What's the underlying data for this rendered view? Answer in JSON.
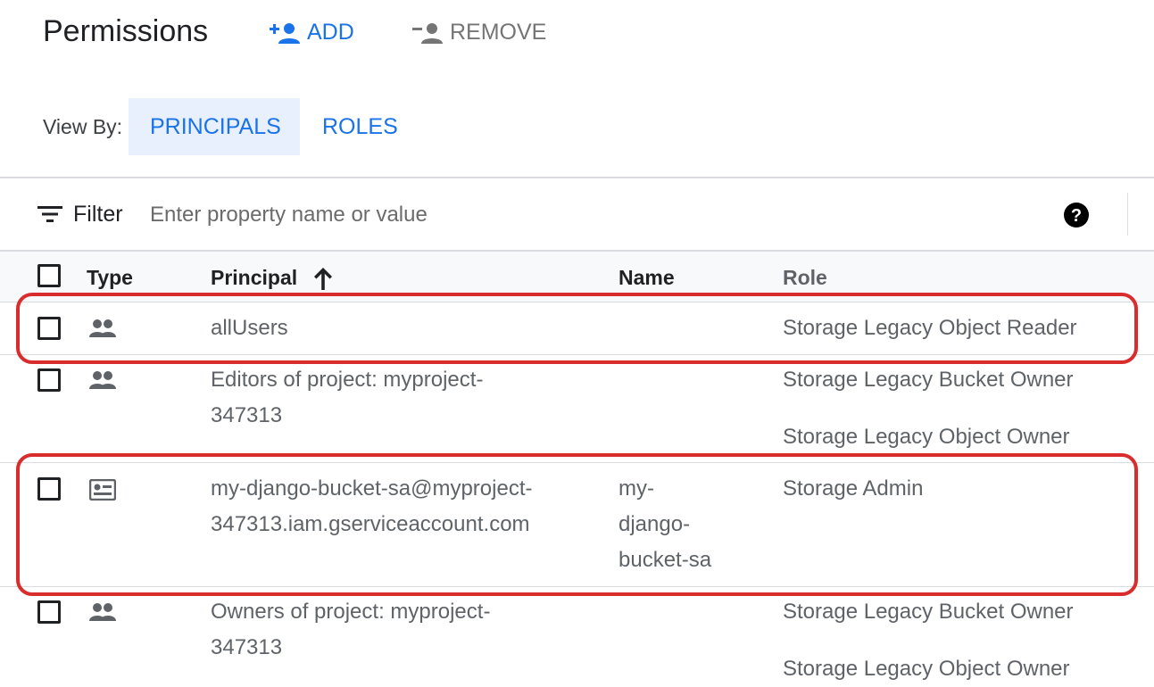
{
  "page": {
    "title": "Permissions",
    "add_label": "ADD",
    "remove_label": "REMOVE"
  },
  "view": {
    "label": "View By:",
    "tabs": [
      {
        "label": "PRINCIPALS",
        "active": true
      },
      {
        "label": "ROLES",
        "active": false
      }
    ]
  },
  "filter": {
    "label": "Filter",
    "placeholder": "Enter property name or value"
  },
  "table": {
    "columns": {
      "type": "Type",
      "principal": "Principal",
      "name": "Name",
      "role": "Role"
    },
    "sort": {
      "column": "Principal",
      "direction": "ascending"
    },
    "rows": [
      {
        "type_icon": "group-icon",
        "principal_lines": [
          "allUsers"
        ],
        "name_lines": [],
        "roles": [
          "Storage Legacy Object Reader"
        ]
      },
      {
        "type_icon": "group-icon",
        "principal_lines": [
          "Editors of project: myproject-",
          "347313"
        ],
        "name_lines": [],
        "roles": [
          "Storage Legacy Bucket Owner",
          "Storage Legacy Object Owner"
        ]
      },
      {
        "type_icon": "service-account-icon",
        "principal_lines": [
          "my-django-bucket-sa@myproject-",
          "347313.iam.gserviceaccount.com"
        ],
        "name_lines": [
          "my-",
          "django-",
          "bucket-sa"
        ],
        "roles": [
          "Storage Admin"
        ]
      },
      {
        "type_icon": "group-icon",
        "principal_lines": [
          "Owners of project: myproject-",
          "347313"
        ],
        "name_lines": [],
        "roles": [
          "Storage Legacy Bucket Owner",
          "Storage Legacy Object Owner"
        ]
      }
    ]
  },
  "colors": {
    "accent": "#1a73e8",
    "highlight": "#d92d2d",
    "active_tab_bg": "#e8f0fe"
  }
}
